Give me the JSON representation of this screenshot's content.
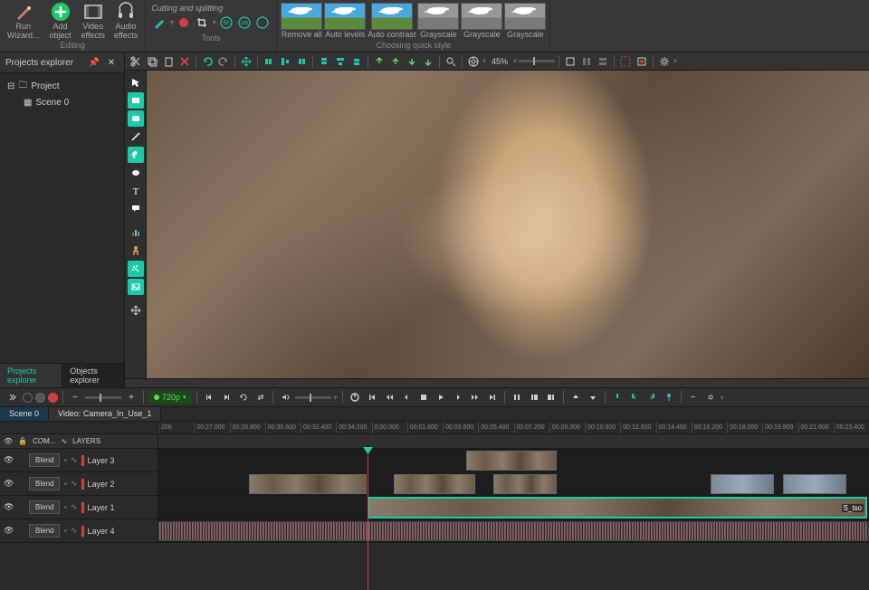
{
  "ribbon": {
    "run_wizard": "Run\nWizard...",
    "add_object": "Add\nobject",
    "video_effects": "Video\neffects",
    "audio_effects": "Audio\neffects",
    "editing_group": "Editing",
    "cutting_splitting": "Cutting and splitting",
    "tools_group": "Tools",
    "styles": [
      {
        "label": "Remove all",
        "gray": false
      },
      {
        "label": "Auto levels",
        "gray": false
      },
      {
        "label": "Auto contrast",
        "gray": false
      },
      {
        "label": "Grayscale",
        "gray": true
      },
      {
        "label": "Grayscale",
        "gray": true
      },
      {
        "label": "Grayscale",
        "gray": true
      }
    ],
    "quick_style_group": "Choosing quick style"
  },
  "projects": {
    "title": "Projects explorer",
    "root": "Project",
    "scenes": [
      "Scene 0"
    ],
    "tabs": [
      "Projects explorer",
      "Objects explorer"
    ]
  },
  "toolbar": {
    "zoom": "45%"
  },
  "playback": {
    "resolution": "720p"
  },
  "timeline": {
    "tabs": [
      "Scene 0",
      "Video: Camera_In_Use_1"
    ],
    "ticks": [
      "200",
      "00:27.000",
      "00:28.800",
      "00:30.600",
      "00:32.400",
      "00:34.200",
      "0:00.000",
      "00:01.800",
      "00:03.600",
      "00:05.400",
      "00:07.200",
      "00:09.000",
      "00:10.800",
      "00:12.600",
      "00:14.400",
      "00:16.200",
      "00:18.000",
      "00:19.800",
      "00:21.600",
      "00:23.400"
    ],
    "header_left": [
      "COM...",
      "LAYERS"
    ],
    "layers": [
      {
        "name": "Layer 3",
        "blend": "Blend"
      },
      {
        "name": "Layer 2",
        "blend": "Blend"
      },
      {
        "name": "Layer 1",
        "blend": "Blend"
      },
      {
        "name": "Layer 4",
        "blend": "Blend"
      }
    ],
    "clip_label": "S_tso"
  }
}
